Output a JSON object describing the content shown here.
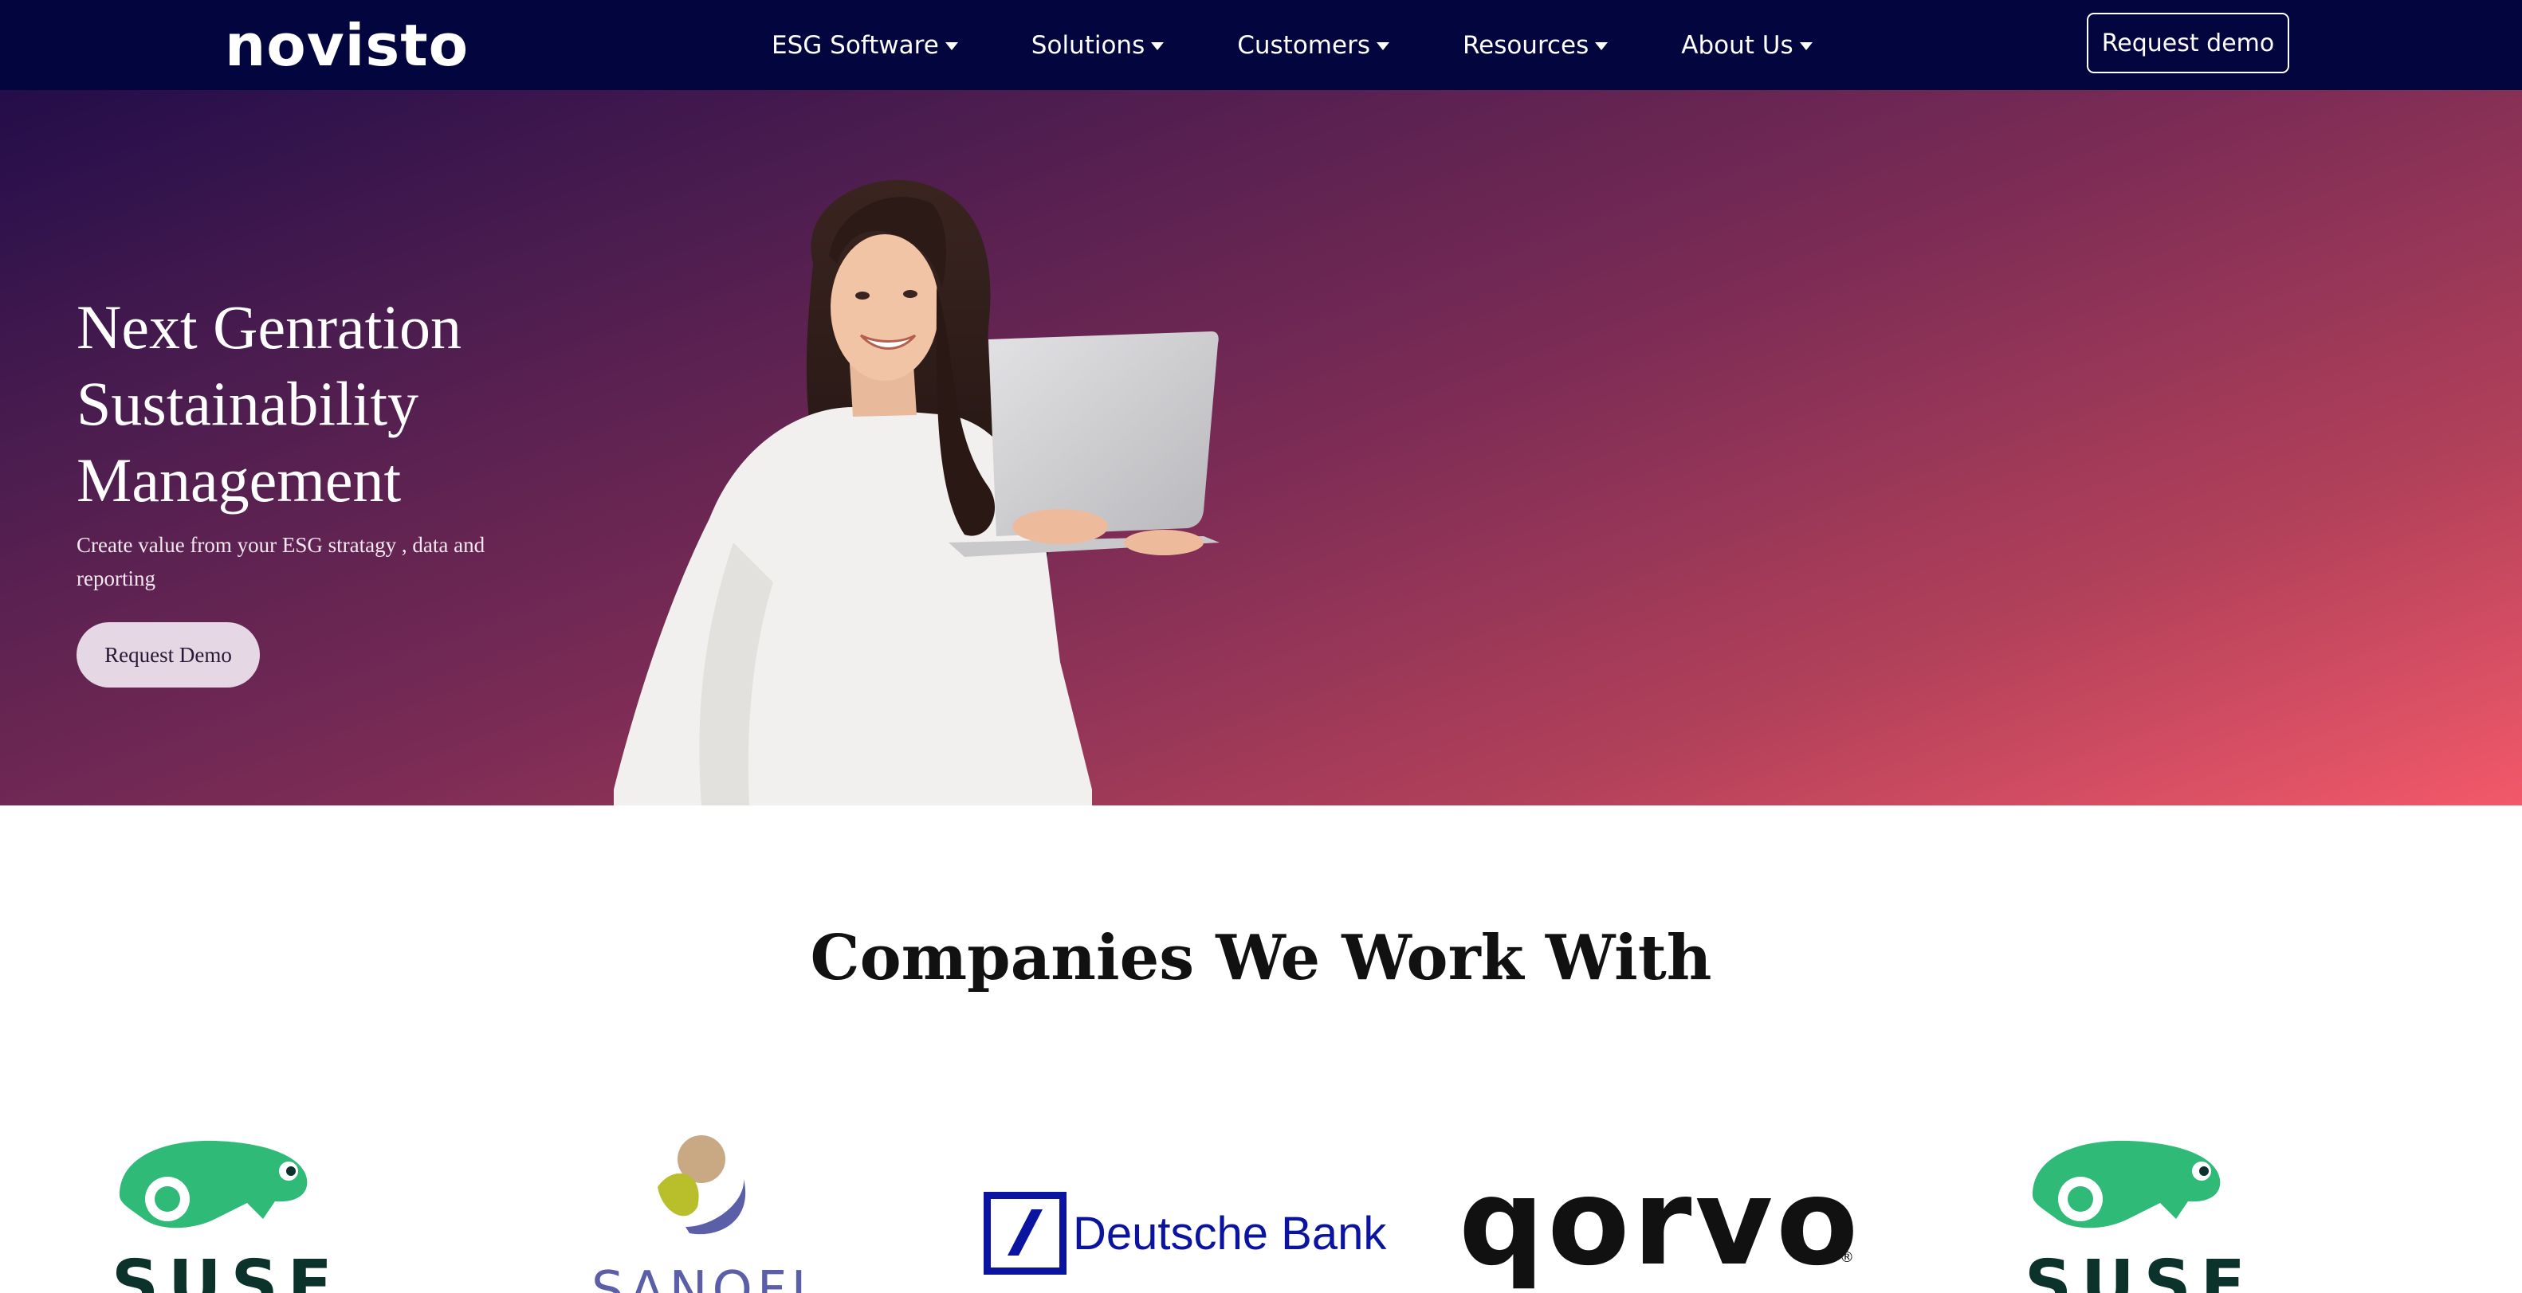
{
  "nav": {
    "logo": "novisto",
    "items": [
      {
        "label": "ESG Software"
      },
      {
        "label": "Solutions"
      },
      {
        "label": "Customers"
      },
      {
        "label": "Resources"
      },
      {
        "label": "About Us"
      }
    ],
    "cta": "Request demo"
  },
  "hero": {
    "title_lines": [
      "Next Genration",
      "Sustainability",
      "Management"
    ],
    "subtitle": "Create value from your ESG stratagy , data and reporting",
    "button": "Request Demo",
    "gradient_colors": [
      "#230d4a",
      "#7a2b55",
      "#f2596a"
    ]
  },
  "companies": {
    "title": "Companies We Work With",
    "logos": [
      {
        "name": "SUSE",
        "icon": "chameleon-icon",
        "color": "#30ba78"
      },
      {
        "name": "SANOFI",
        "icon": "sanofi-bird-icon",
        "color": "#5a5fa8"
      },
      {
        "name": "Deutsche Bank",
        "icon": "db-slash-icon",
        "color": "#0a14a0"
      },
      {
        "name": "qorvo",
        "icon": "qorvo-wordmark",
        "color": "#111111",
        "mark": "®"
      },
      {
        "name": "SUSE",
        "icon": "chameleon-icon",
        "color": "#30ba78"
      }
    ]
  },
  "colors": {
    "navbar": "#03053f",
    "hero_button_bg": "#e6d7e4"
  }
}
